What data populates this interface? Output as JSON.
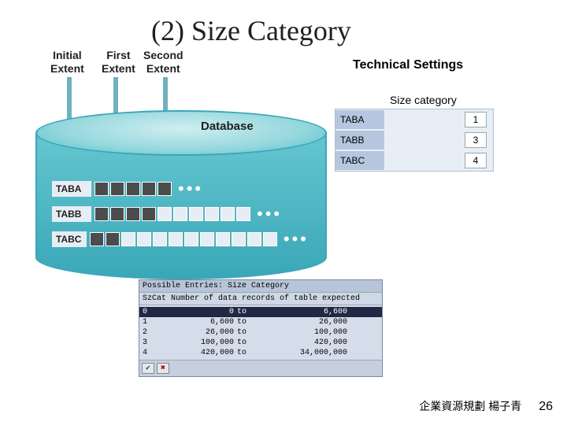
{
  "title": "(2) Size Category",
  "extents": {
    "initial": "Initial\nExtent",
    "first": "First\nExtent",
    "second": "Second\nExtent"
  },
  "technical_settings_label": "Technical Settings",
  "size_category_label": "Size category",
  "panel_rows": [
    {
      "name": "TABA",
      "value": "1"
    },
    {
      "name": "TABB",
      "value": "3"
    },
    {
      "name": "TABC",
      "value": "4"
    }
  ],
  "database_label": "Database",
  "db_tables": [
    {
      "name": "TABA",
      "cells": 5,
      "dark_upto": 5,
      "dots_after_cell": 5
    },
    {
      "name": "TABB",
      "cells": 10,
      "dark_upto": 4,
      "dots_after_cell": 10
    },
    {
      "name": "TABC",
      "cells": 12,
      "dark_upto": 2,
      "dots_after_cell": 12
    }
  ],
  "dialog": {
    "title": "Possible Entries: Size Category",
    "header": "SzCat Number of data records of table expected",
    "rows": [
      {
        "cat": "0",
        "from": "0",
        "to_word": "to",
        "to": "6,600",
        "selected": true
      },
      {
        "cat": "1",
        "from": "6,600",
        "to_word": "to",
        "to": "26,000",
        "selected": false
      },
      {
        "cat": "2",
        "from": "26,000",
        "to_word": "to",
        "to": "100,000",
        "selected": false
      },
      {
        "cat": "3",
        "from": "100,000",
        "to_word": "to",
        "to": "420,000",
        "selected": false
      },
      {
        "cat": "4",
        "from": "420,000",
        "to_word": "to",
        "to": "34,000,000",
        "selected": false
      }
    ],
    "ok": "✔",
    "cancel": "✖"
  },
  "footer_text": "企業資源規劃   楊子青",
  "page_number": "26"
}
